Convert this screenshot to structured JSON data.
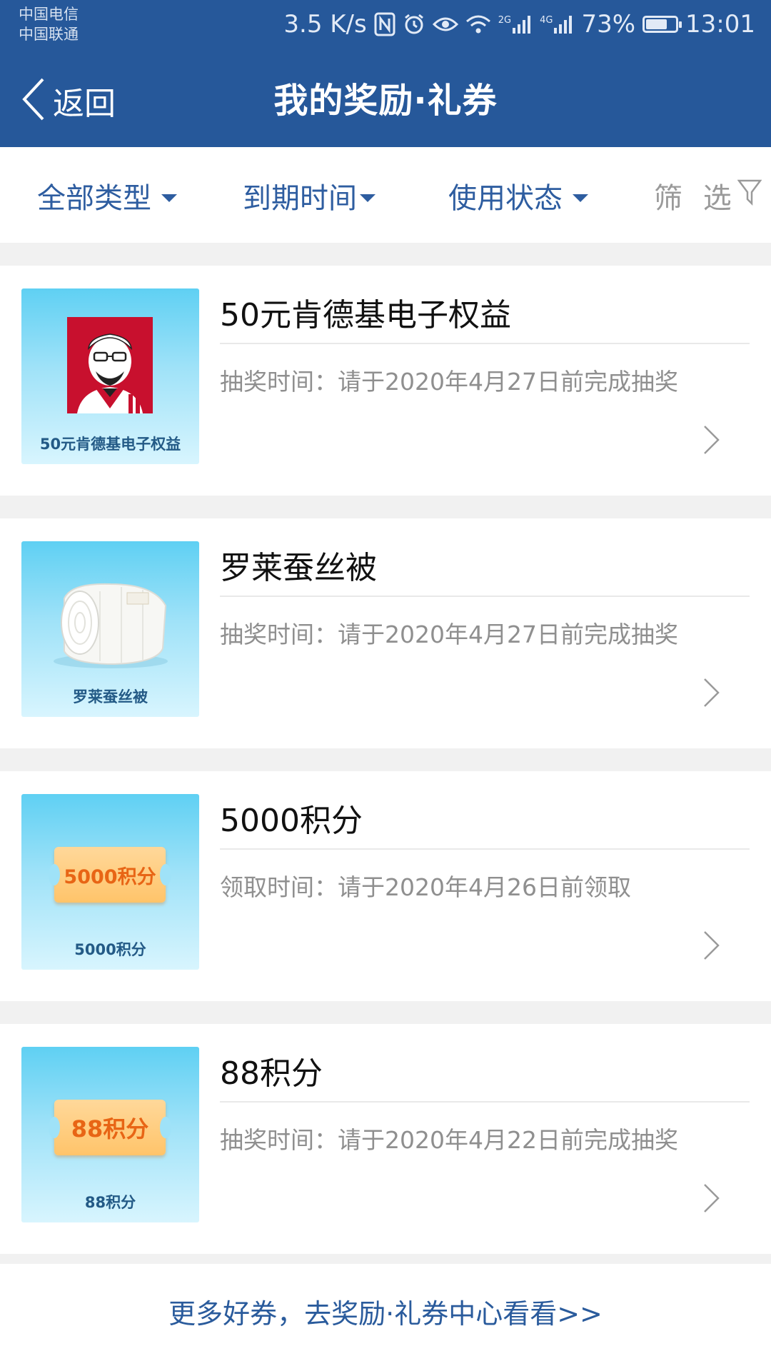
{
  "status_bar": {
    "carrier_1": "中国电信",
    "carrier_2": "中国联通",
    "speed": "3.5 K/s",
    "network_1": "2G",
    "network_2": "4G",
    "battery": "73%",
    "battery_level": 0.73,
    "time": "13:01"
  },
  "nav": {
    "back_label": "返回",
    "title": "我的奖励·礼券"
  },
  "filters": {
    "type": "全部类型",
    "expiry": "到期时间",
    "status": "使用状态",
    "screen": "筛 选"
  },
  "coupons": [
    {
      "title": "50元肯德基电子权益",
      "subtitle": "抽奖时间：请于2020年4月27日前完成抽奖",
      "thumb_caption": "50元肯德基电子权益",
      "thumb_icon": "kfc-logo-icon"
    },
    {
      "title": "罗莱蚕丝被",
      "subtitle": "抽奖时间：请于2020年4月27日前完成抽奖",
      "thumb_caption": "罗莱蚕丝被",
      "thumb_icon": "quilt-icon"
    },
    {
      "title": "5000积分",
      "subtitle": "领取时间：请于2020年4月26日前领取",
      "thumb_caption": "5000积分",
      "thumb_ticket": "5000积分"
    },
    {
      "title": "88积分",
      "subtitle": "抽奖时间：请于2020年4月22日前完成抽奖",
      "thumb_caption": "88积分",
      "thumb_ticket": "88积分"
    }
  ],
  "footer": {
    "link": "更多好券，去奖励·礼券中心看看>>"
  },
  "colors": {
    "brand_blue": "#26589a",
    "link_blue": "#2e5da0",
    "muted_text": "#8f8f8f",
    "ticket_orange": "#e86515"
  }
}
